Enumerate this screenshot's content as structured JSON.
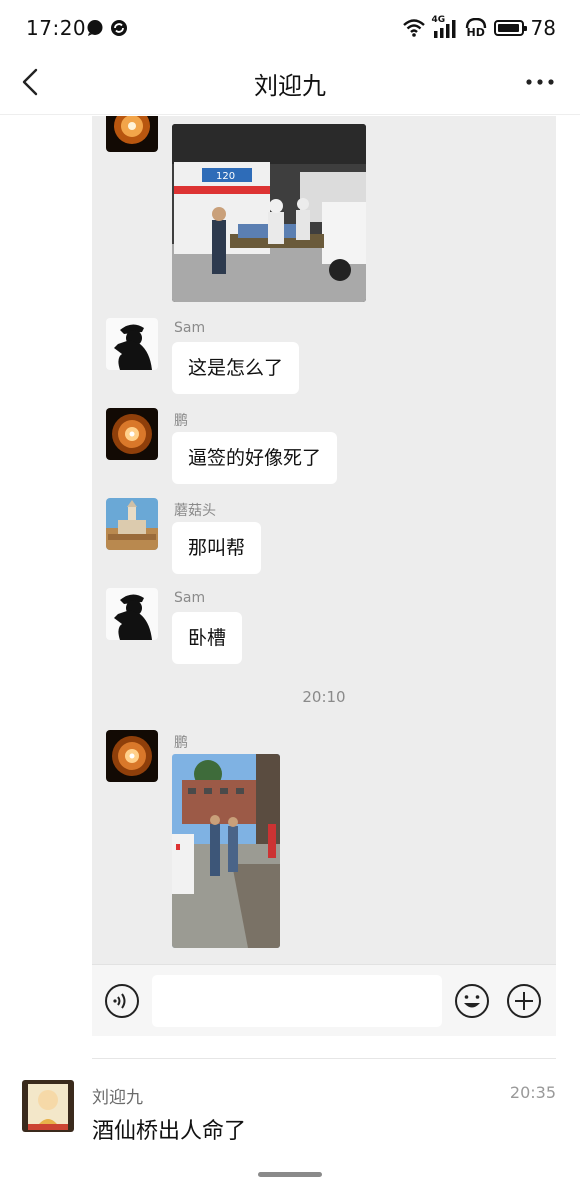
{
  "status_bar": {
    "time": "17:20",
    "left_icons": [
      "chat-bubble-icon",
      "sync-icon"
    ],
    "network_label": "4G",
    "hd_label": "HD",
    "battery_percent": "78"
  },
  "nav": {
    "title": "刘迎九"
  },
  "chat": {
    "messages": [
      {
        "sender": "",
        "type": "image"
      },
      {
        "sender": "Sam",
        "type": "text",
        "text": "这是怎么了"
      },
      {
        "sender": "鹏",
        "type": "text",
        "text": "逼签的好像死了"
      },
      {
        "sender": "蘑菇头",
        "type": "text",
        "text": "那叫帮"
      },
      {
        "sender": "Sam",
        "type": "text",
        "text": "卧槽"
      },
      {
        "sender": "鹏",
        "type": "image"
      }
    ],
    "time_separator": "20:10",
    "ambulance_sign": "120"
  },
  "comment": {
    "author": "刘迎九",
    "time": "20:35",
    "text": "酒仙桥出人命了"
  },
  "colors": {
    "chat_background": "#ededed",
    "bubble": "#ffffff",
    "meta_gray": "#8a8a8a"
  }
}
